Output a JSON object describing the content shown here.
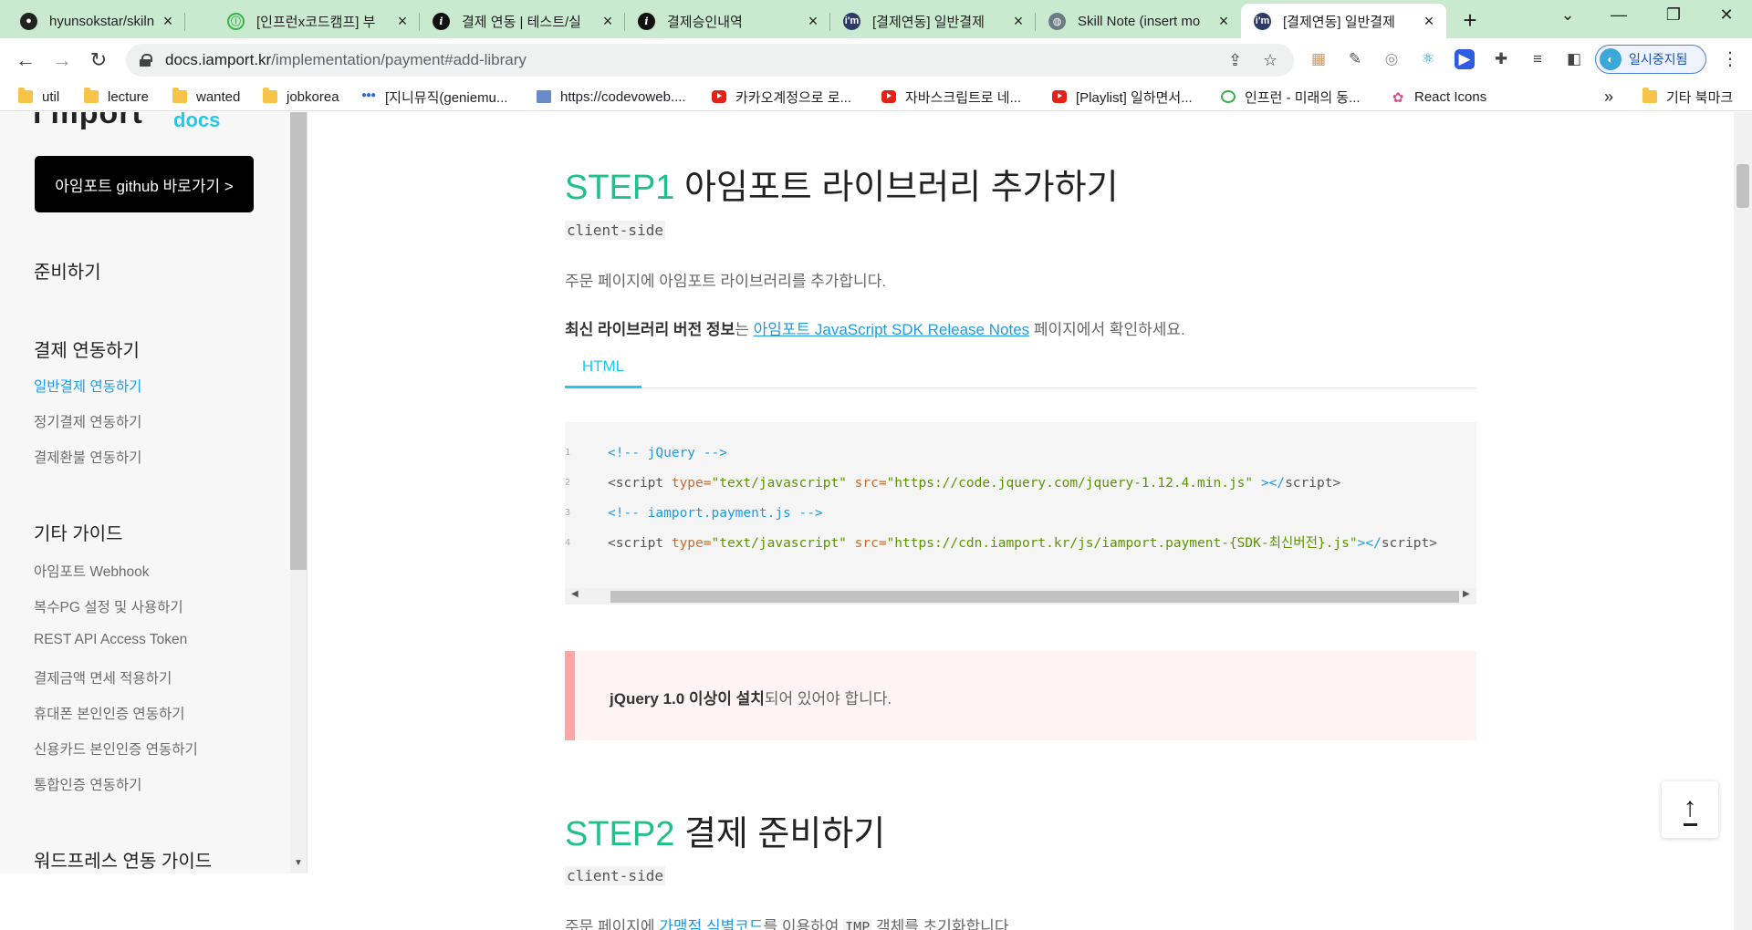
{
  "browser": {
    "tabs": [
      {
        "title": "hyunsokstar/skilnote",
        "favicon": "github-icon"
      },
      {
        "title": "[인프런x코드캠프] 부",
        "favicon": "inflearn-icon"
      },
      {
        "title": "결제 연동 | 테스트/실",
        "favicon": "info-icon"
      },
      {
        "title": "결제승인내역",
        "favicon": "info-icon"
      },
      {
        "title": "[결제연동] 일반결제",
        "favicon": "iamport-icon"
      },
      {
        "title": "Skill Note (insert mo",
        "favicon": "globe-icon"
      },
      {
        "title": "[결제연동] 일반결제",
        "favicon": "iamport-icon",
        "active": true
      }
    ],
    "new_tab": "+",
    "window_controls": {
      "tab_search": "⌄",
      "minimize": "—",
      "restore": "❐",
      "close": "✕"
    },
    "url": {
      "host": "docs.iamport.kr",
      "path": "/implementation/payment#add-library"
    },
    "profile_label": "일시중지됨",
    "bookmarks": [
      {
        "label": "util",
        "icon": "folder"
      },
      {
        "label": "lecture",
        "icon": "folder"
      },
      {
        "label": "wanted",
        "icon": "folder"
      },
      {
        "label": "jobkorea",
        "icon": "folder"
      },
      {
        "label": "[지니뮤직(geniemu...",
        "icon": "dots"
      },
      {
        "label": "https://codevoweb....",
        "icon": "pc"
      },
      {
        "label": "카카오계정으로 로...",
        "icon": "youtube"
      },
      {
        "label": "자바스크립트로 네...",
        "icon": "youtube"
      },
      {
        "label": "[Playlist] 일하면서...",
        "icon": "youtube"
      },
      {
        "label": "인프런 - 미래의 동...",
        "icon": "inflearn"
      },
      {
        "label": "React Icons",
        "icon": "react"
      }
    ],
    "bookmarks_overflow": "»",
    "other_bookmarks": "기타 북마크"
  },
  "sidebar": {
    "logo_docs": "docs",
    "github_button": "아임포트 github 바로가기 >",
    "sections": [
      {
        "heading": "준비하기",
        "items": []
      },
      {
        "heading": "결제 연동하기",
        "items": [
          "일반결제 연동하기",
          "정기결제 연동하기",
          "결제환불 연동하기"
        ]
      },
      {
        "heading": "기타 가이드",
        "items": [
          "아임포트 Webhook",
          "복수PG 설정 및 사용하기",
          "REST API Access Token",
          "결제금액 면세 적용하기",
          "휴대폰 본인인증 연동하기",
          "신용카드 본인인증 연동하기",
          "통합인증 연동하기"
        ]
      },
      {
        "heading": "워드프레스 연동 가이드",
        "items": []
      }
    ],
    "active_item": "일반결제 연동하기"
  },
  "content": {
    "step1": {
      "num": "STEP1",
      "title": " 아임포트 라이브러리 추가하기",
      "badge": "client-side",
      "desc": "주문 페이지에 아임포트 라이브러리를 추가합니다.",
      "version_bold": "최신 라이브러리 버전 정보",
      "version_mid": "는 ",
      "version_link": "아임포트 JavaScript SDK Release Notes",
      "version_tail": " 페이지에서 확인하세요.",
      "code_tab": "HTML",
      "code_lines": [
        {
          "n": "1",
          "comment": "<!-- jQuery -->"
        },
        {
          "n": "2",
          "tag_open": "<script",
          "attr1": " type=",
          "val1": "\"text/javascript\"",
          "attr2": " src=",
          "val2": "\"https://code.jquery.com/jquery-1.12.4.min.js\"",
          "close": " ></",
          "tag_close": "script>"
        },
        {
          "n": "3",
          "comment": "<!-- iamport.payment.js -->"
        },
        {
          "n": "4",
          "tag_open": "<script",
          "attr1": " type=",
          "val1": "\"text/javascript\"",
          "attr2": " src=",
          "val2": "\"https://cdn.iamport.kr/js/iamport.payment-{SDK-최신버전}.js\"",
          "close": "></",
          "tag_close": "script>"
        }
      ],
      "notice_bold": "jQuery 1.0 이상이 설치",
      "notice_tail": "되어 있어야 합니다."
    },
    "step2": {
      "num": "STEP2",
      "title": " 결제 준비하기",
      "badge": "client-side",
      "desc_start": "주문 페이지에 ",
      "desc_link": "가맹점 식별코드",
      "desc_mid": "를 이용하여 ",
      "desc_code": "IMP",
      "desc_end": " 객체를 초기화합니다."
    },
    "to_top": "↑"
  }
}
